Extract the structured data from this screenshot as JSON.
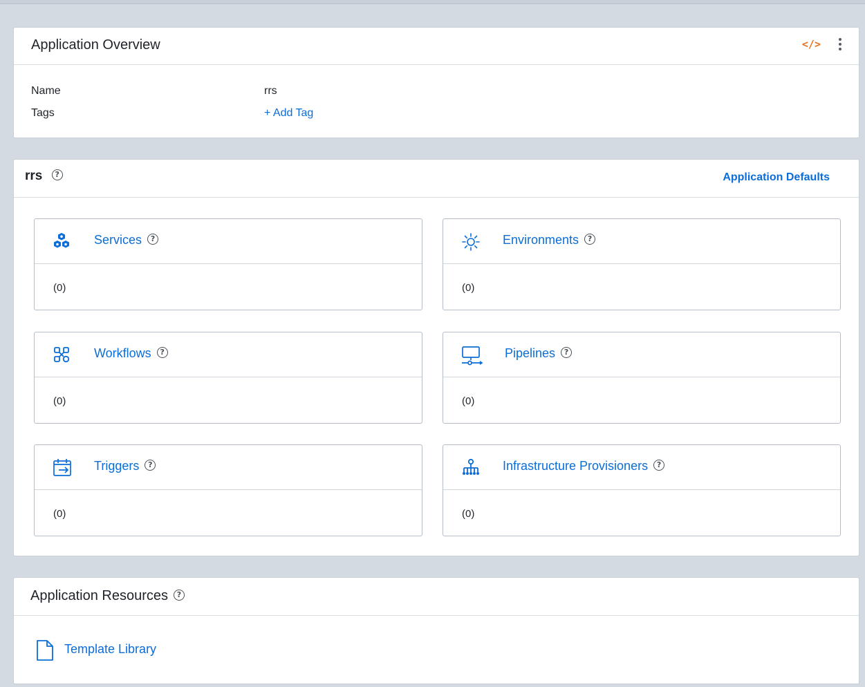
{
  "colors": {
    "link": "#0b6dd8",
    "accent_orange": "#e8711b",
    "page_background": "#d3dae1"
  },
  "overview": {
    "title": "Application Overview",
    "code_icon_text": "</>",
    "name_label": "Name",
    "name_value": "rrs",
    "tags_label": "Tags",
    "add_tag_label": "+ Add Tag"
  },
  "app": {
    "title": "rrs",
    "defaults_link": "Application Defaults",
    "cards": [
      {
        "label": "Services",
        "count": "(0)",
        "icon": "services-cubes-icon"
      },
      {
        "label": "Environments",
        "count": "(0)",
        "icon": "environments-sun-icon"
      },
      {
        "label": "Workflows",
        "count": "(0)",
        "icon": "workflows-nodes-icon"
      },
      {
        "label": "Pipelines",
        "count": "(0)",
        "icon": "pipelines-monitor-icon"
      },
      {
        "label": "Triggers",
        "count": "(0)",
        "icon": "triggers-calendar-icon"
      },
      {
        "label": "Infrastructure Provisioners",
        "count": "(0)",
        "icon": "infrastructure-tree-icon"
      }
    ]
  },
  "resources": {
    "title": "Application Resources",
    "items": [
      {
        "label": "Template Library",
        "icon": "document-icon"
      }
    ]
  }
}
